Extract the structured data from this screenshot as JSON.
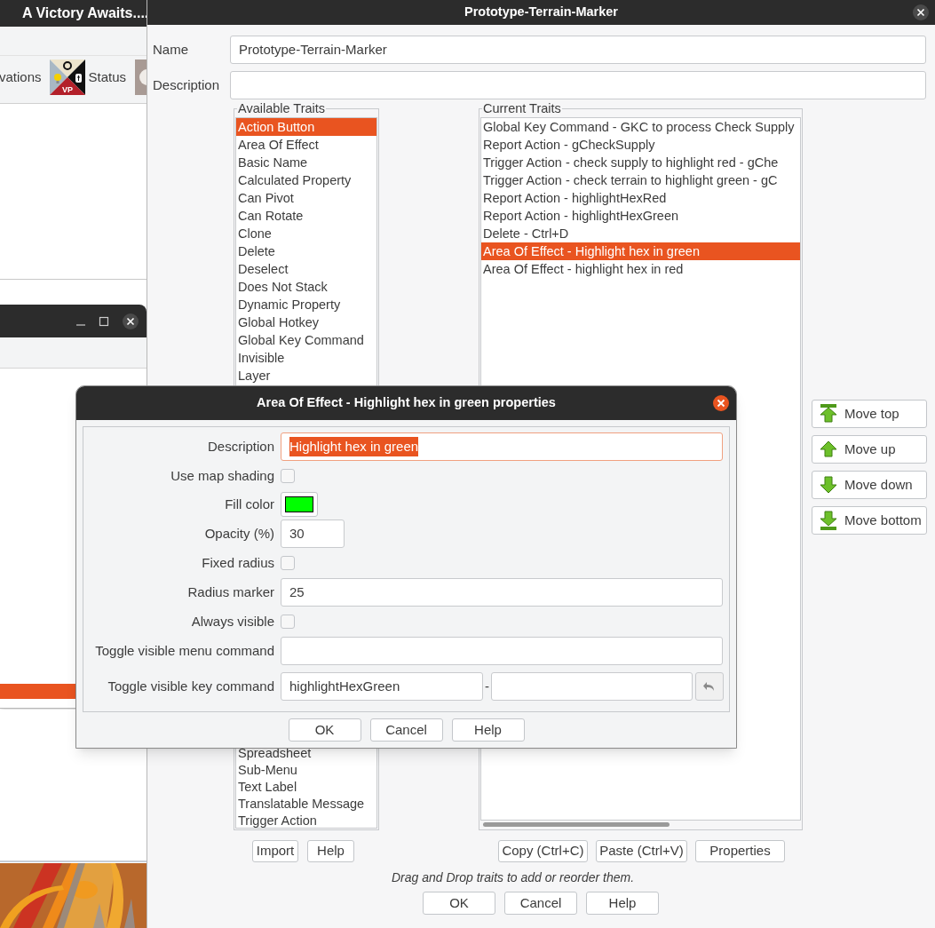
{
  "back_window": {
    "title": "A Victory Awaits....",
    "toolbar": [
      {
        "kind": "text",
        "label": "vations"
      },
      {
        "kind": "status",
        "label": "Status",
        "icon_text": "VP"
      },
      {
        "kind": "icon"
      }
    ]
  },
  "main_dialog": {
    "title": "Prototype-Terrain-Marker",
    "name": {
      "label": "Name",
      "value": "Prototype-Terrain-Marker"
    },
    "description": {
      "label": "Description"
    },
    "available_traits": {
      "title": "Available Traits",
      "items": [
        {
          "label": "Action Button",
          "selected": true
        },
        {
          "label": "Area Of Effect",
          "selected": false
        },
        {
          "label": "Basic Name",
          "selected": false
        },
        {
          "label": "Calculated Property",
          "selected": false
        },
        {
          "label": "Can Pivot",
          "selected": false
        },
        {
          "label": "Can Rotate",
          "selected": false
        },
        {
          "label": "Clone",
          "selected": false
        },
        {
          "label": "Delete",
          "selected": false
        },
        {
          "label": "Deselect",
          "selected": false
        },
        {
          "label": "Does Not Stack",
          "selected": false
        },
        {
          "label": "Dynamic Property",
          "selected": false
        },
        {
          "label": "Global Hotkey",
          "selected": false
        },
        {
          "label": "Global Key Command",
          "selected": false
        },
        {
          "label": "Invisible",
          "selected": false
        },
        {
          "label": "Layer",
          "selected": false
        }
      ],
      "items_below_dialog": [
        {
          "label": "Spreadsheet",
          "selected": false
        },
        {
          "label": "Sub-Menu",
          "selected": false
        },
        {
          "label": "Text Label",
          "selected": false
        },
        {
          "label": "Translatable Message",
          "selected": false
        },
        {
          "label": "Trigger Action",
          "selected": false
        }
      ]
    },
    "current_traits": {
      "title": "Current Traits",
      "items": [
        {
          "label": "Global Key Command - GKC to process Check Supply",
          "selected": false
        },
        {
          "label": "Report Action - gCheckSupply",
          "selected": false
        },
        {
          "label": "Trigger Action - check supply to highlight red - gChe",
          "selected": false
        },
        {
          "label": "Trigger Action - check terrain to highlight green - gC",
          "selected": false
        },
        {
          "label": "Report Action - highlightHexRed",
          "selected": false
        },
        {
          "label": "Report Action - highlightHexGreen",
          "selected": false
        },
        {
          "label": "Delete - Ctrl+D",
          "selected": false
        },
        {
          "label": "Area Of Effect - Highlight hex in green",
          "selected": true
        },
        {
          "label": "Area Of Effect - highlight hex in red",
          "selected": false
        }
      ]
    },
    "move_buttons": [
      {
        "kind": "top",
        "label": "Move top"
      },
      {
        "kind": "up",
        "label": "Move up"
      },
      {
        "kind": "down",
        "label": "Move down"
      },
      {
        "kind": "bottom",
        "label": "Move bottom"
      }
    ],
    "left_buttons": [
      "Import",
      "Help"
    ],
    "right_buttons": [
      "Copy (Ctrl+C)",
      "Paste (Ctrl+V)",
      "Properties"
    ],
    "hint": "Drag and Drop traits to add or reorder them.",
    "footer_buttons": [
      "OK",
      "Cancel",
      "Help"
    ]
  },
  "properties_dialog": {
    "title": "Area Of Effect - Highlight hex in green properties",
    "rows": [
      {
        "kind": "text",
        "label": "Description",
        "value": "Highlight hex in green",
        "selected": true
      },
      {
        "kind": "checkbox",
        "label": "Use map shading",
        "checked": false
      },
      {
        "kind": "color",
        "label": "Fill color",
        "color": "#00ff00"
      },
      {
        "kind": "short_text",
        "label": "Opacity (%)",
        "value": "30"
      },
      {
        "kind": "checkbox",
        "label": "Fixed radius",
        "checked": false
      },
      {
        "kind": "text",
        "label": "Radius marker",
        "value": "25",
        "selected": false
      },
      {
        "kind": "checkbox",
        "label": "Always visible",
        "checked": false
      },
      {
        "kind": "text",
        "label": "Toggle visible menu command",
        "selected": false
      },
      {
        "kind": "keystroke",
        "label": "Toggle visible key command",
        "value": "highlightHexGreen",
        "separator": "-"
      }
    ],
    "buttons": [
      "OK",
      "Cancel",
      "Help"
    ]
  }
}
